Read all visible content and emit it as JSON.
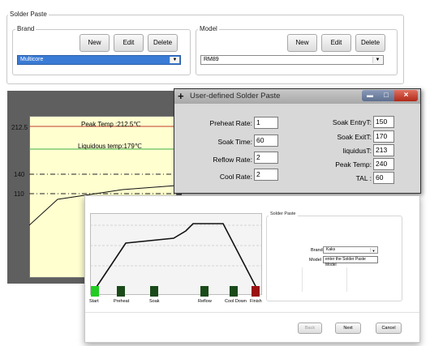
{
  "solder_paste": {
    "title": "Solder Paste",
    "brand": {
      "legend": "Brand",
      "new": "New",
      "edit": "Edit",
      "delete": "Delete",
      "value": "Multicore"
    },
    "model": {
      "legend": "Model",
      "new": "New",
      "edit": "Edit",
      "delete": "Delete",
      "value": "RM89"
    }
  },
  "profile_chart": {
    "peak_label": "Peak Temp :212.5℃",
    "liquidous_label": "Liquidous temp:179℃",
    "y_ticks": [
      "212.5",
      "140",
      "110"
    ]
  },
  "user_dialog": {
    "title": "User-defined Solder Paste",
    "fields_left": [
      {
        "label": "Preheat Rate:",
        "value": "1"
      },
      {
        "label": "Soak Time:",
        "value": "60"
      },
      {
        "label": "Reflow Rate:",
        "value": "2"
      },
      {
        "label": "Cool Rate:",
        "value": "2"
      }
    ],
    "fields_right": [
      {
        "label": "Soak EntryT:",
        "value": "150"
      },
      {
        "label": "Soak ExitT:",
        "value": "170"
      },
      {
        "label": "liquidusT:",
        "value": "213"
      },
      {
        "label": "Peak Temp:",
        "value": "240"
      },
      {
        "label": "TAL :",
        "value": "60"
      }
    ]
  },
  "wizard": {
    "stage_labels": [
      "Start",
      "Preheat",
      "Soak",
      "Reflow",
      "Cool Down",
      "Finish"
    ],
    "panel_legend": "Solder Paste",
    "brand_label": "Brand",
    "brand_value": "Kaks",
    "model_label": "Model",
    "model_value": "enter the Solder Paste Model",
    "back": "Back",
    "next": "Next",
    "cancel": "Cancel"
  },
  "colors": {
    "selection": "#3a7bd5",
    "chart_bg": "#ffffd0",
    "peak_line": "#c0392b",
    "liquidous_line": "#3cb043",
    "dialog_title_bg": "#b4b4b4",
    "stage_start": "#22cc22",
    "stage_mid": "#1a4a1a",
    "stage_finish": "#991111"
  }
}
